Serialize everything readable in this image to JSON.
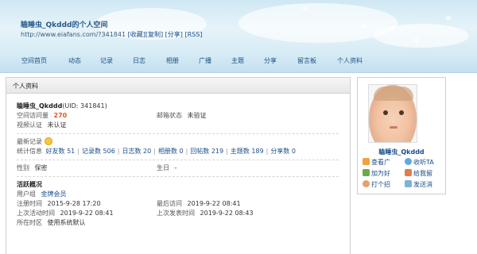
{
  "header": {
    "title": "瞌睡虫_Qkddd的个人空间",
    "url": "http://www.eiafans.com/?341841",
    "link_collect": "[收藏]",
    "link_copy": "[复制]",
    "link_share": "[分享]",
    "link_rss": "[RSS]"
  },
  "nav": [
    "空间首页",
    "动态",
    "记录",
    "日志",
    "相册",
    "广播",
    "主题",
    "分享",
    "留言板",
    "个人资料"
  ],
  "panel": {
    "heading": "个人资料",
    "username": "瞌睡虫_Qkddd",
    "uid": "(UID: 341841)",
    "visits_label": "空间访问量",
    "visits_value": "270",
    "email_label": "邮箱状态",
    "email_value": "未验证",
    "video_label": "视频认证",
    "video_value": "未认证",
    "recent_label": "最新记录",
    "stats_label": "统计信息",
    "stats": [
      "好友数 51",
      "记录数 506",
      "日志数 20",
      "相册数 0",
      "回帖数 219",
      "主题数 189",
      "分享数 0"
    ],
    "gender_label": "性别",
    "gender_value": "保密",
    "birthday_label": "生日",
    "birthday_value": "-",
    "activity_title": "活跃概况",
    "group_label": "用户组",
    "group_value": "金牌会员",
    "reg_label": "注册时间",
    "reg_value": "2015-9-28 17:20",
    "last_visit_label": "最后访问",
    "last_visit_value": "2019-9-22 08:41",
    "last_active_label": "上次活动时间",
    "last_active_value": "2019-9-22 08:41",
    "last_post_label": "上次发表时间",
    "last_post_value": "2019-9-22 08:43",
    "timezone_label": "所在时区",
    "timezone_value": "使用系统默认"
  },
  "sidebar": {
    "name": "瞌睡虫_Qkddd",
    "actions": [
      "查看广",
      "收听TA",
      "加为好",
      "给我留",
      "打个招",
      "发送消"
    ]
  },
  "colors": {
    "link": "#1a4e8a",
    "accent": "#e8541b"
  }
}
